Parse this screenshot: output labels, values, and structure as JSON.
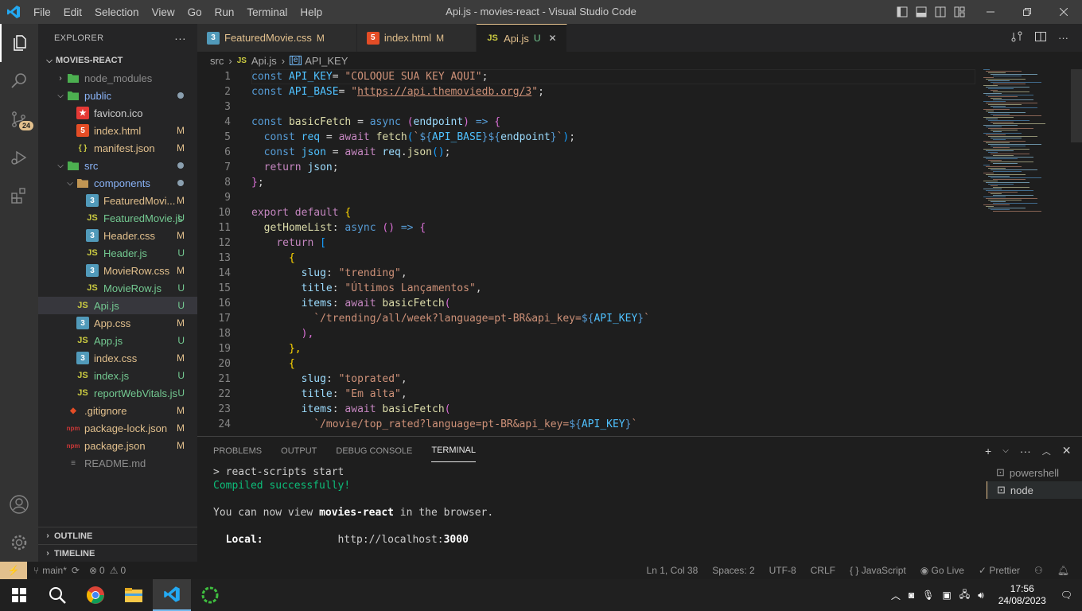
{
  "window": {
    "title": "Api.js - movies-react - Visual Studio Code"
  },
  "menu": [
    "File",
    "Edit",
    "Selection",
    "View",
    "Go",
    "Run",
    "Terminal",
    "Help"
  ],
  "activity": {
    "scm_badge": "24"
  },
  "explorer": {
    "title": "EXPLORER",
    "more": "···",
    "root": "MOVIES-REACT",
    "items": [
      {
        "name": "node_modules",
        "depth": 1,
        "kind": "folder",
        "expanded": false,
        "status": "",
        "dot": false,
        "dim": true
      },
      {
        "name": "public",
        "depth": 1,
        "kind": "folder",
        "expanded": true,
        "status": "",
        "dot": true
      },
      {
        "name": "favicon.ico",
        "depth": 2,
        "kind": "star",
        "status": ""
      },
      {
        "name": "index.html",
        "depth": 2,
        "kind": "html",
        "status": "M"
      },
      {
        "name": "manifest.json",
        "depth": 2,
        "kind": "json",
        "status": "M"
      },
      {
        "name": "src",
        "depth": 1,
        "kind": "folder",
        "expanded": true,
        "status": "",
        "dot": true
      },
      {
        "name": "components",
        "depth": 2,
        "kind": "folder",
        "expanded": true,
        "status": "",
        "dot": true
      },
      {
        "name": "FeaturedMovi...",
        "depth": 3,
        "kind": "css",
        "status": "M"
      },
      {
        "name": "FeaturedMovie.js",
        "depth": 3,
        "kind": "js",
        "status": "U"
      },
      {
        "name": "Header.css",
        "depth": 3,
        "kind": "css",
        "status": "M"
      },
      {
        "name": "Header.js",
        "depth": 3,
        "kind": "js",
        "status": "U"
      },
      {
        "name": "MovieRow.css",
        "depth": 3,
        "kind": "css",
        "status": "M"
      },
      {
        "name": "MovieRow.js",
        "depth": 3,
        "kind": "js",
        "status": "U"
      },
      {
        "name": "Api.js",
        "depth": 2,
        "kind": "js",
        "status": "U",
        "selected": true
      },
      {
        "name": "App.css",
        "depth": 2,
        "kind": "css",
        "status": "M"
      },
      {
        "name": "App.js",
        "depth": 2,
        "kind": "js",
        "status": "U"
      },
      {
        "name": "index.css",
        "depth": 2,
        "kind": "css",
        "status": "M"
      },
      {
        "name": "index.js",
        "depth": 2,
        "kind": "js",
        "status": "U"
      },
      {
        "name": "reportWebVitals.js",
        "depth": 2,
        "kind": "js",
        "status": "U"
      },
      {
        "name": ".gitignore",
        "depth": 1,
        "kind": "git",
        "status": "M"
      },
      {
        "name": "package-lock.json",
        "depth": 1,
        "kind": "npm",
        "status": "M"
      },
      {
        "name": "package.json",
        "depth": 1,
        "kind": "npm",
        "status": "M"
      },
      {
        "name": "README.md",
        "depth": 1,
        "kind": "md",
        "status": ""
      }
    ],
    "outline": "OUTLINE",
    "timeline": "TIMELINE"
  },
  "tabs": [
    {
      "label": "FeaturedMovie.css",
      "kind": "css",
      "status": "M",
      "active": false
    },
    {
      "label": "index.html",
      "kind": "html",
      "status": "M",
      "active": false
    },
    {
      "label": "Api.js",
      "kind": "js",
      "status": "U",
      "active": true
    }
  ],
  "breadcrumb": {
    "folder": "src",
    "file": "Api.js",
    "symbol": "API_KEY"
  },
  "code_lines": [
    [
      [
        "kb",
        "const "
      ],
      [
        "cn",
        "API_KEY"
      ],
      [
        "",
        "= "
      ],
      [
        "st2",
        "\"COLOQUE SUA KEY AQUI\""
      ],
      [
        "",
        ";"
      ]
    ],
    [
      [
        "kb",
        "const "
      ],
      [
        "cn",
        "API_BASE"
      ],
      [
        "",
        "= "
      ],
      [
        "st2",
        "\""
      ],
      [
        "st2u",
        "https://api.themoviedb.org/3"
      ],
      [
        "st2",
        "\""
      ],
      [
        "",
        ";"
      ]
    ],
    [],
    [
      [
        "kb",
        "const "
      ],
      [
        "fn",
        "basicFetch"
      ],
      [
        "",
        " = "
      ],
      [
        "kb",
        "async "
      ],
      [
        "br2",
        "("
      ],
      [
        "vr",
        "endpoint"
      ],
      [
        "br2",
        ")"
      ],
      [
        "",
        " "
      ],
      [
        "kb",
        "=>"
      ],
      [
        "",
        " "
      ],
      [
        "br2",
        "{"
      ]
    ],
    [
      [
        "",
        "  "
      ],
      [
        "kb",
        "const "
      ],
      [
        "cn",
        "req"
      ],
      [
        "",
        " = "
      ],
      [
        "kw",
        "await "
      ],
      [
        "fn",
        "fetch"
      ],
      [
        "br3",
        "("
      ],
      [
        "st2",
        "`"
      ],
      [
        "kb",
        "${"
      ],
      [
        "cn",
        "API_BASE"
      ],
      [
        "kb",
        "}${"
      ],
      [
        "vr",
        "endpoint"
      ],
      [
        "kb",
        "}"
      ],
      [
        "st2",
        "`"
      ],
      [
        "br3",
        ")"
      ],
      [
        "",
        ";"
      ]
    ],
    [
      [
        "",
        "  "
      ],
      [
        "kb",
        "const "
      ],
      [
        "cn",
        "json"
      ],
      [
        "",
        " = "
      ],
      [
        "kw",
        "await "
      ],
      [
        "vr",
        "req"
      ],
      [
        "",
        "."
      ],
      [
        "fn",
        "json"
      ],
      [
        "br3",
        "()"
      ],
      [
        "",
        ";"
      ]
    ],
    [
      [
        "",
        "  "
      ],
      [
        "kw",
        "return "
      ],
      [
        "vr",
        "json"
      ],
      [
        "",
        ";"
      ]
    ],
    [
      [
        "br2",
        "}"
      ],
      [
        "",
        ";"
      ]
    ],
    [],
    [
      [
        "kw",
        "export default "
      ],
      [
        "br1",
        "{"
      ]
    ],
    [
      [
        "",
        "  "
      ],
      [
        "fn",
        "getHomeList"
      ],
      [
        "",
        ": "
      ],
      [
        "kb",
        "async "
      ],
      [
        "br2",
        "()"
      ],
      [
        "",
        " "
      ],
      [
        "kb",
        "=>"
      ],
      [
        "",
        " "
      ],
      [
        "br2",
        "{"
      ]
    ],
    [
      [
        "",
        "    "
      ],
      [
        "kw",
        "return "
      ],
      [
        "br3",
        "["
      ]
    ],
    [
      [
        "",
        "      "
      ],
      [
        "br1",
        "{"
      ]
    ],
    [
      [
        "",
        "        "
      ],
      [
        "vr",
        "slug"
      ],
      [
        "",
        ": "
      ],
      [
        "st2",
        "\"trending\""
      ],
      [
        "",
        ","
      ]
    ],
    [
      [
        "",
        "        "
      ],
      [
        "vr",
        "title"
      ],
      [
        "",
        ": "
      ],
      [
        "st2",
        "\"Últimos Lançamentos\""
      ],
      [
        "",
        ","
      ]
    ],
    [
      [
        "",
        "        "
      ],
      [
        "vr",
        "items"
      ],
      [
        "",
        ": "
      ],
      [
        "kw",
        "await "
      ],
      [
        "fn",
        "basicFetch"
      ],
      [
        "br2",
        "("
      ]
    ],
    [
      [
        "",
        "          "
      ],
      [
        "st2",
        "`/trending/all/week?language=pt-BR&api_key="
      ],
      [
        "kb",
        "${"
      ],
      [
        "cn",
        "API_KEY"
      ],
      [
        "kb",
        "}"
      ],
      [
        "st2",
        "`"
      ]
    ],
    [
      [
        "",
        "        "
      ],
      [
        "br2",
        "),"
      ]
    ],
    [
      [
        "",
        "      "
      ],
      [
        "br1",
        "},"
      ]
    ],
    [
      [
        "",
        "      "
      ],
      [
        "br1",
        "{"
      ]
    ],
    [
      [
        "",
        "        "
      ],
      [
        "vr",
        "slug"
      ],
      [
        "",
        ": "
      ],
      [
        "st2",
        "\"toprated\""
      ],
      [
        "",
        ","
      ]
    ],
    [
      [
        "",
        "        "
      ],
      [
        "vr",
        "title"
      ],
      [
        "",
        ": "
      ],
      [
        "st2",
        "\"Em alta\""
      ],
      [
        "",
        ","
      ]
    ],
    [
      [
        "",
        "        "
      ],
      [
        "vr",
        "items"
      ],
      [
        "",
        ": "
      ],
      [
        "kw",
        "await "
      ],
      [
        "fn",
        "basicFetch"
      ],
      [
        "br2",
        "("
      ]
    ],
    [
      [
        "",
        "          "
      ],
      [
        "st2",
        "`/movie/top_rated?language=pt-BR&api_key="
      ],
      [
        "kb",
        "${"
      ],
      [
        "cn",
        "API_KEY"
      ],
      [
        "kb",
        "}"
      ],
      [
        "st2",
        "`"
      ]
    ]
  ],
  "panel": {
    "tabs": [
      "PROBLEMS",
      "OUTPUT",
      "DEBUG CONSOLE",
      "TERMINAL"
    ],
    "active_tab": "TERMINAL",
    "terminal_lines": [
      "> react-scripts start",
      "Compiled successfully!",
      "",
      "You can now view movies-react in the browser.",
      "",
      "  Local:            http://localhost:3000"
    ],
    "terminal_bold": {
      "app": "movies-react",
      "local_label": "Local:",
      "port": "3000"
    },
    "terminals": [
      "powershell",
      "node"
    ]
  },
  "status": {
    "branch": "main*",
    "errors": "0",
    "warnings": "0",
    "position": "Ln 1, Col 38",
    "spaces": "Spaces: 2",
    "encoding": "UTF-8",
    "eol": "CRLF",
    "language": "JavaScript",
    "golive": "Go Live",
    "prettier": "Prettier"
  },
  "taskbar": {
    "time": "17:56",
    "date": "24/08/2023"
  },
  "colors": {
    "accent": "#007acc",
    "modified": "#e2c08d",
    "untracked": "#73c991",
    "statusbar": "#1e1e1e"
  }
}
